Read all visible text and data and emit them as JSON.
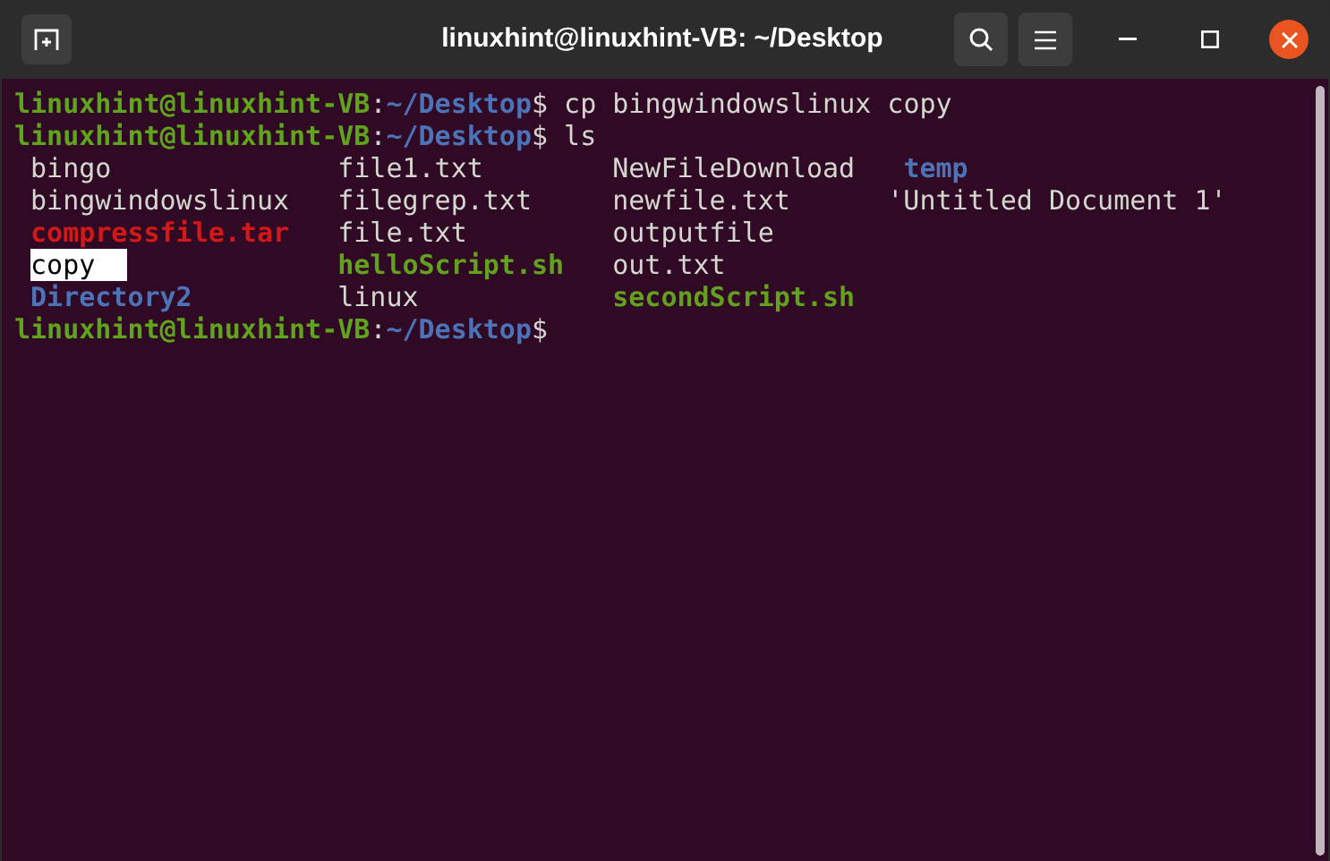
{
  "window": {
    "title": "linuxhint@linuxhint-VB: ~/Desktop"
  },
  "terminal": {
    "lines": [
      {
        "kind": "prompt",
        "user_host": "linuxhint@linuxhint-VB",
        "separator": ":",
        "path": "~/Desktop",
        "symbol": "$",
        "command": "cp bingwindowslinux copy"
      },
      {
        "kind": "prompt",
        "user_host": "linuxhint@linuxhint-VB",
        "separator": ":",
        "path": "~/Desktop",
        "symbol": "$",
        "command": "ls"
      },
      {
        "kind": "listing",
        "rows": [
          [
            {
              "name": "bingo",
              "kind": "file"
            },
            {
              "name": "file1.txt",
              "kind": "file"
            },
            {
              "name": "NewFileDownload",
              "kind": "file"
            },
            {
              "name": "temp",
              "kind": "dir",
              "pad": true
            }
          ],
          [
            {
              "name": "bingwindowslinux",
              "kind": "file"
            },
            {
              "name": "filegrep.txt",
              "kind": "file"
            },
            {
              "name": "newfile.txt",
              "kind": "file"
            },
            {
              "name": "'Untitled Document 1'",
              "kind": "file"
            }
          ],
          [
            {
              "name": "compressfile.tar",
              "kind": "archive"
            },
            {
              "name": "file.txt",
              "kind": "file"
            },
            {
              "name": "outputfile",
              "kind": "file"
            }
          ],
          [
            {
              "name": "copy",
              "kind": "highlighted"
            },
            {
              "name": "helloScript.sh",
              "kind": "exec"
            },
            {
              "name": "out.txt",
              "kind": "file"
            }
          ],
          [
            {
              "name": "Directory2",
              "kind": "dir"
            },
            {
              "name": "linux",
              "kind": "file"
            },
            {
              "name": "secondScript.sh",
              "kind": "exec"
            }
          ]
        ]
      },
      {
        "kind": "prompt",
        "user_host": "linuxhint@linuxhint-VB",
        "separator": ":",
        "path": "~/Desktop",
        "symbol": "$"
      }
    ]
  }
}
